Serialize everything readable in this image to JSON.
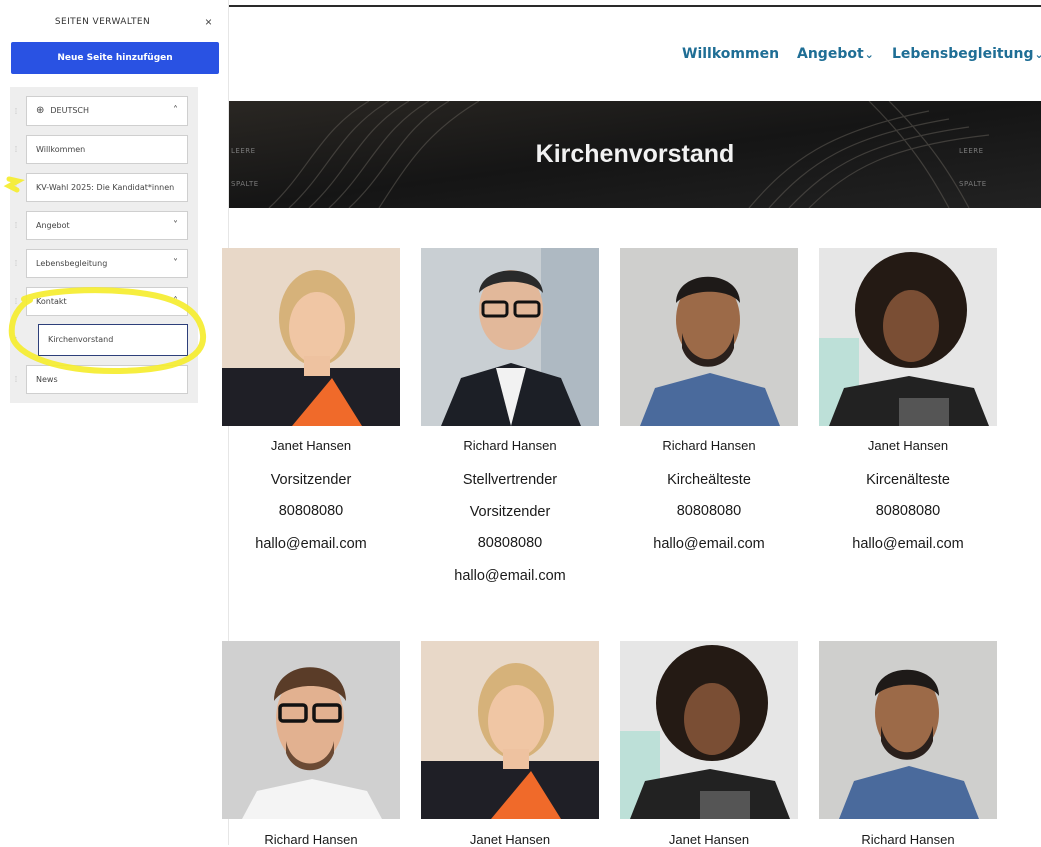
{
  "panel": {
    "title": "SEITEN VERWALTEN",
    "close": "×",
    "add_button": "Neue Seite hinzufügen",
    "language": "DEUTSCH",
    "items": [
      {
        "label": "Willkommen"
      },
      {
        "label": "KV-Wahl 2025: Die Kandidat*innen"
      },
      {
        "label": "Angebot"
      },
      {
        "label": "Lebensbegleitung"
      },
      {
        "label": "Kontakt"
      },
      {
        "label": "Kirchenvorstand"
      },
      {
        "label": "News"
      }
    ],
    "highlight_color": "#f5ec2a",
    "accent": "#2952e3"
  },
  "site": {
    "nav": [
      {
        "label": "Willkommen"
      },
      {
        "label": "Angebot"
      },
      {
        "label": "Lebensbegleitung"
      }
    ],
    "nav_color": "#1f6e95",
    "banner": {
      "title": "Kirchenvorstand",
      "side_left": [
        "LEERE",
        "SPALTE"
      ],
      "side_right": [
        "LEERE",
        "SPALTE"
      ]
    },
    "members": [
      {
        "name": "Janet Hansen",
        "role": [
          "Vorsitzender"
        ],
        "phone": "80808080",
        "email": "hallo@email.com"
      },
      {
        "name": "Richard Hansen",
        "role": [
          "Stellvertrender",
          "Vorsitzender"
        ],
        "phone": "80808080",
        "email": "hallo@email.com"
      },
      {
        "name": "Richard Hansen",
        "role": [
          "Kircheälteste"
        ],
        "phone": "80808080",
        "email": "hallo@email.com"
      },
      {
        "name": "Janet Hansen",
        "role": [
          "Kircenälteste"
        ],
        "phone": "80808080",
        "email": "hallo@email.com"
      },
      {
        "name": "Richard Hansen"
      },
      {
        "name": "Janet Hansen"
      },
      {
        "name": "Janet Hansen"
      },
      {
        "name": "Richard Hansen"
      }
    ]
  }
}
